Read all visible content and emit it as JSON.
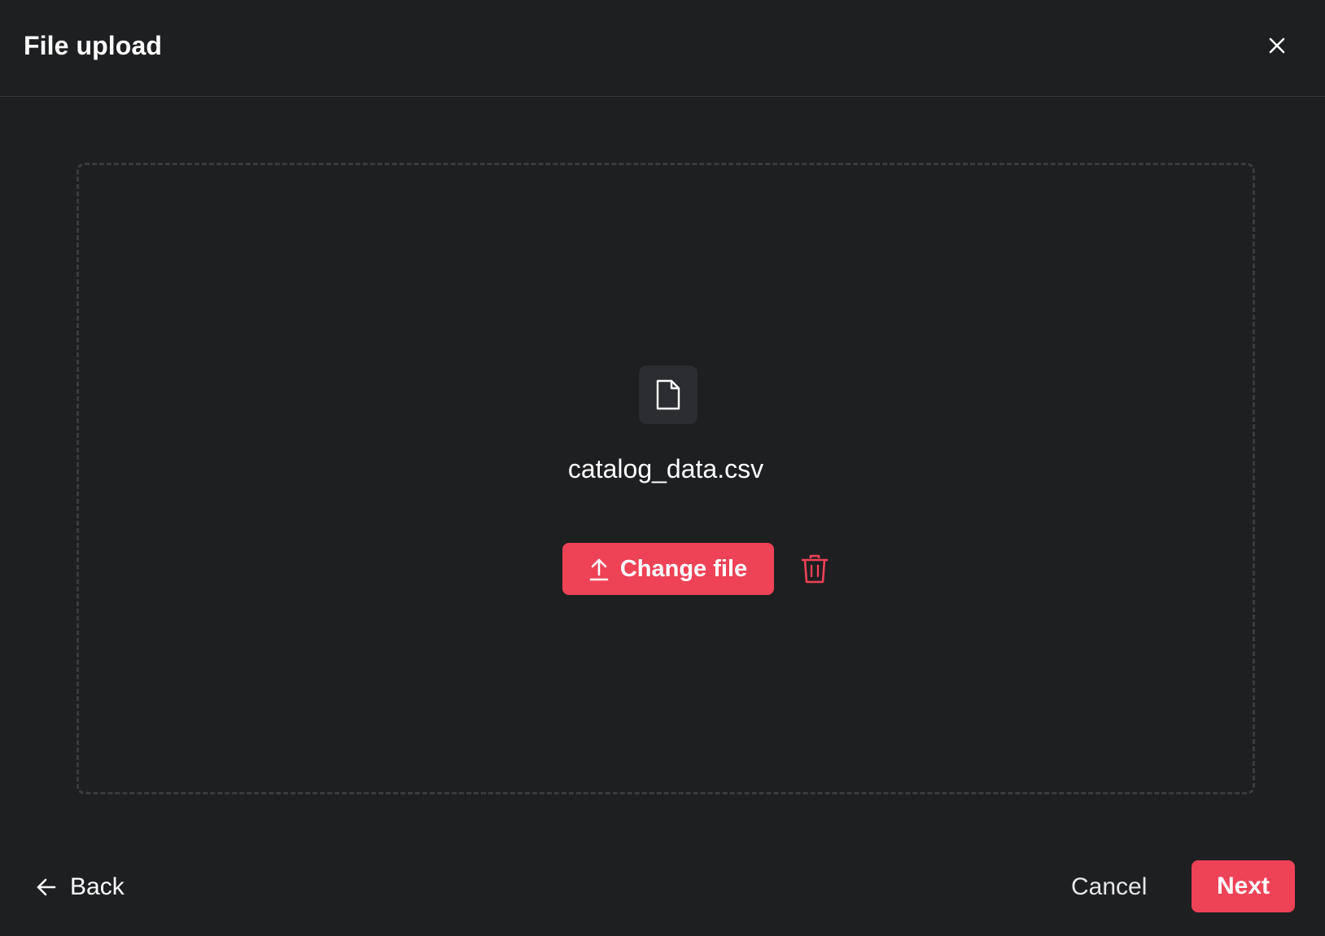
{
  "header": {
    "title": "File upload",
    "close_icon": "close-icon"
  },
  "dropzone": {
    "file_icon": "document-icon",
    "file_name": "catalog_data.csv",
    "change_file_label": "Change file",
    "change_file_icon": "upload-icon",
    "delete_icon": "trash-icon"
  },
  "footer": {
    "back_label": "Back",
    "back_icon": "arrow-left-icon",
    "cancel_label": "Cancel",
    "next_label": "Next"
  },
  "colors": {
    "background": "#1e1f21",
    "accent": "#ee4256",
    "divider": "#3a3b3e",
    "text": "#ffffff"
  }
}
